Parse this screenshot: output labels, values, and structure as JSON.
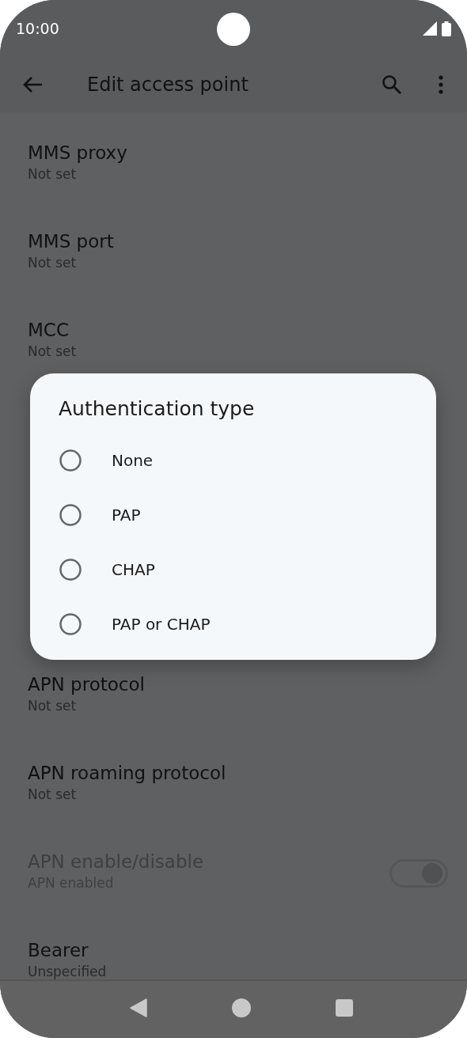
{
  "status_bar": {
    "time": "10:00"
  },
  "app_bar": {
    "title": "Edit access point"
  },
  "settings": [
    {
      "kind": "text",
      "title": "MMS proxy",
      "summary": "Not set",
      "disabled": false
    },
    {
      "kind": "text",
      "title": "MMS port",
      "summary": "Not set",
      "disabled": false
    },
    {
      "kind": "text",
      "title": "MCC",
      "summary": "Not set",
      "disabled": false
    },
    {
      "kind": "gap"
    },
    {
      "kind": "text",
      "title": "APN protocol",
      "summary": "Not set",
      "disabled": false
    },
    {
      "kind": "text",
      "title": "APN roaming protocol",
      "summary": "Not set",
      "disabled": false
    },
    {
      "kind": "switch",
      "title": "APN enable/disable",
      "summary": "APN enabled",
      "disabled": true,
      "on": true
    },
    {
      "kind": "text",
      "title": "Bearer",
      "summary": "Unspecified",
      "disabled": false
    }
  ],
  "dialog": {
    "title": "Authentication type",
    "options": [
      {
        "label": "None",
        "selected": false
      },
      {
        "label": "PAP",
        "selected": false
      },
      {
        "label": "CHAP",
        "selected": false
      },
      {
        "label": "PAP or CHAP",
        "selected": false
      }
    ]
  }
}
